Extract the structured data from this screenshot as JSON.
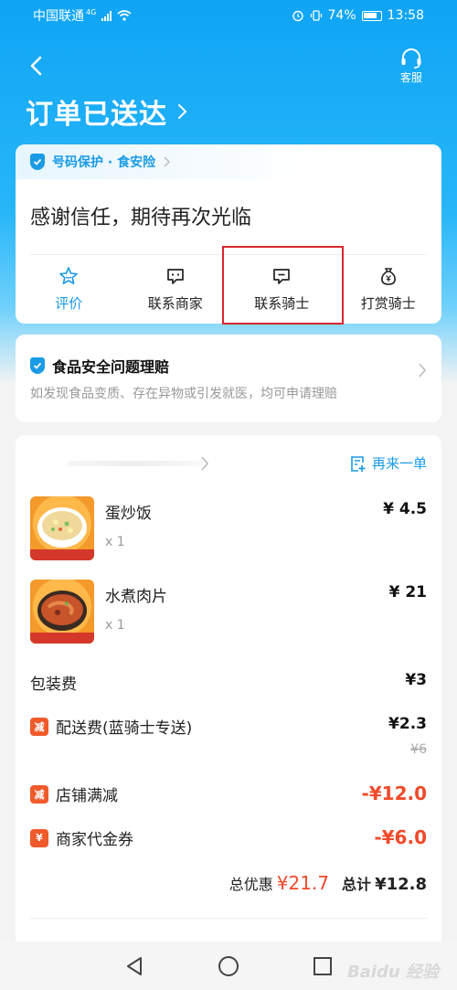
{
  "status_bar": {
    "carrier": "中国联通",
    "network": "4G",
    "battery": "74%",
    "time": "13:58"
  },
  "header": {
    "customer_service_label": "客服",
    "title": "订单已送达"
  },
  "protection": {
    "label": "号码保护 · 食安险"
  },
  "thanks_message": "感谢信任，期待再次光临",
  "actions": [
    {
      "label": "评价",
      "icon": "star-icon"
    },
    {
      "label": "联系商家",
      "icon": "chat-icon"
    },
    {
      "label": "联系骑士",
      "icon": "chat-icon"
    },
    {
      "label": "打赏骑士",
      "icon": "money-bag-icon"
    }
  ],
  "claim": {
    "title": "食品安全问题理赔",
    "subtitle": "如发现食品变质、存在异物或引发就医，均可申请理赔"
  },
  "order": {
    "reorder_label": "再来一单",
    "items": [
      {
        "name": "蛋炒饭",
        "qty": "x 1",
        "price": "¥ 4.5"
      },
      {
        "name": "水煮肉片",
        "qty": "x 1",
        "price": "¥ 21"
      }
    ],
    "packing_fee": {
      "label": "包装费",
      "value": "¥3"
    },
    "delivery_fee": {
      "badge": "减",
      "label": "配送费(蓝骑士专送)",
      "value": "¥2.3",
      "original": "¥6"
    },
    "store_discount": {
      "badge": "减",
      "label": "店铺满减",
      "value": "-¥12.0"
    },
    "voucher": {
      "badge": "¥",
      "label": "商家代金券",
      "value": "-¥6.0"
    },
    "summary": {
      "discount_label": "总优惠",
      "discount_value": "¥21.7",
      "total_label": "总计",
      "total_value": "¥12.8"
    }
  },
  "watermark": "Baidu 经验",
  "colors": {
    "accent": "#1a9be6",
    "discount_red": "#f04a2a",
    "highlight_box": "#d9262f"
  }
}
